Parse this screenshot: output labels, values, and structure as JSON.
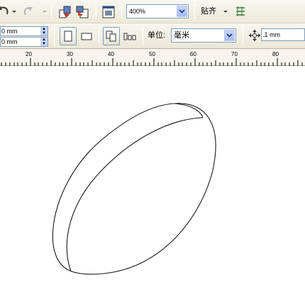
{
  "toolbar": {
    "zoom_value": "400%",
    "snap_label": "贴齐"
  },
  "property_bar": {
    "width_value": "0 mm",
    "height_value": "0 mm",
    "units_label": "单位:",
    "units_value": "毫米",
    "nudge_value": ".1 mm"
  },
  "ruler": {
    "labels": [
      "20",
      "30",
      "40",
      "50",
      "60",
      "70",
      "80"
    ]
  },
  "icons": {
    "undo": "undo-icon",
    "redo": "redo-icon",
    "import": "import-icon",
    "export": "export-icon",
    "application_launcher": "application-launcher-icon",
    "snap_options": "snap-options-icon",
    "portrait": "portrait-icon",
    "landscape": "landscape-icon",
    "all_pages": "all-pages-icon",
    "current_page": "current-page-icon",
    "nudge": "nudge-icon"
  }
}
